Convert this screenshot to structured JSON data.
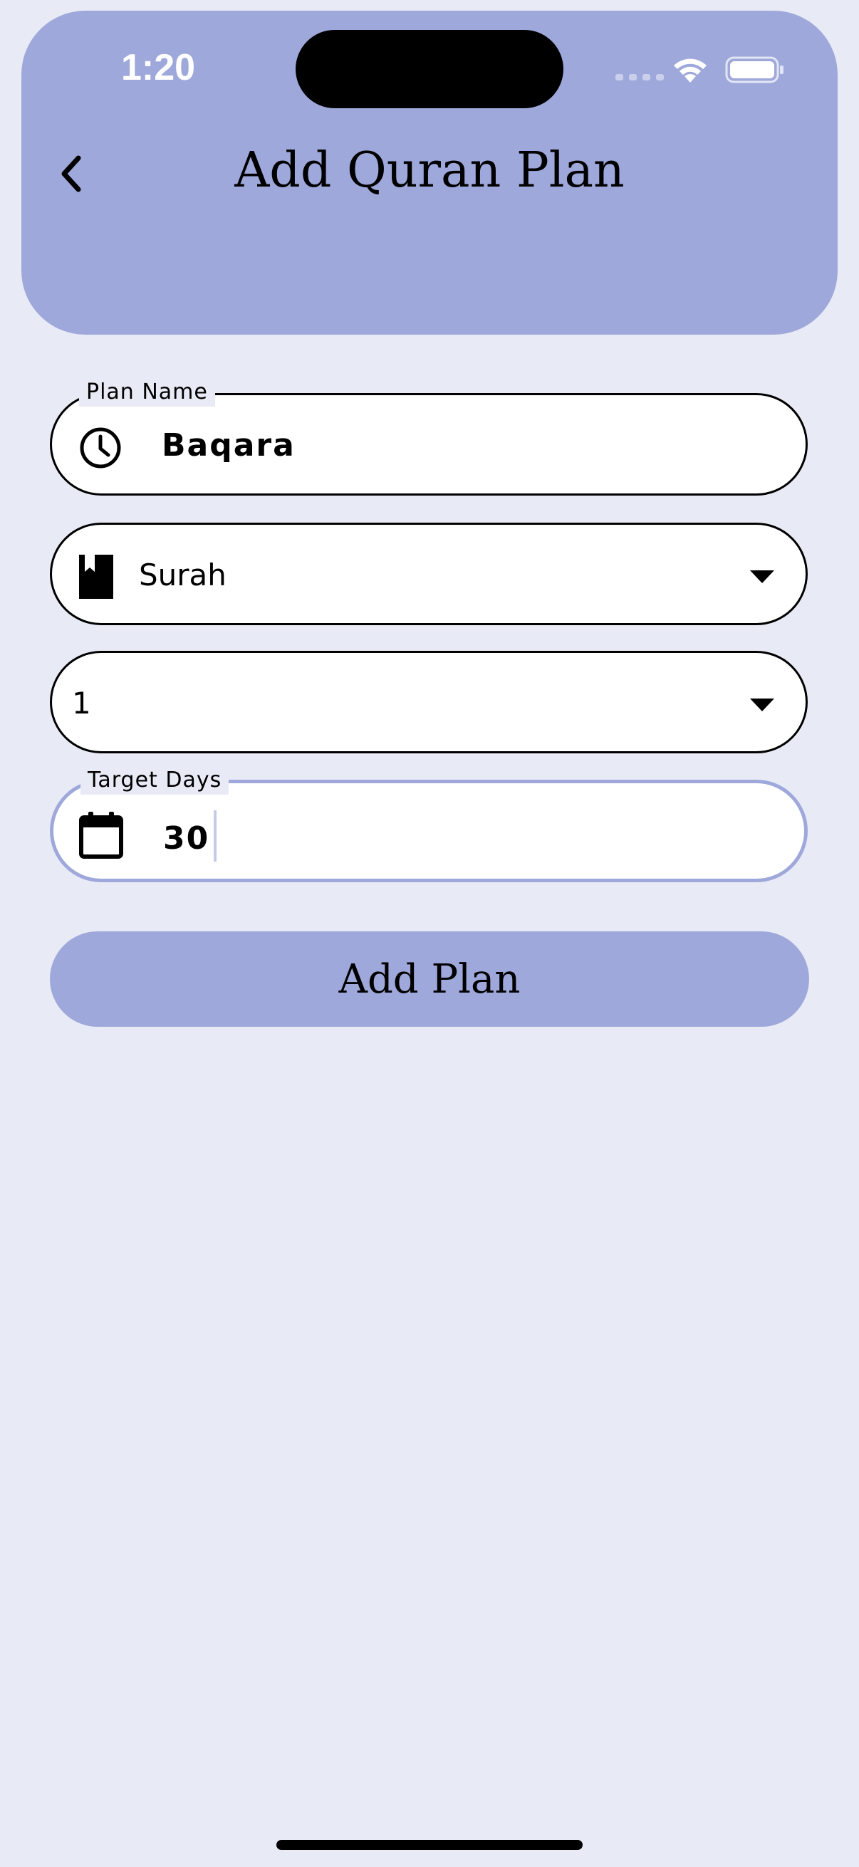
{
  "status_bar": {
    "time": "1:20"
  },
  "header": {
    "title": "Add Quran Plan",
    "back_icon": "chevron-left-icon",
    "background_color": "#9FA8DA"
  },
  "form": {
    "plan_name": {
      "label": "Plan Name",
      "value": "Baqara",
      "icon": "clock-icon"
    },
    "plan_type": {
      "selected": "Surah",
      "icon": "book-bookmark-icon"
    },
    "surah_number": {
      "selected": "1"
    },
    "target_days": {
      "label": "Target Days",
      "value": "30",
      "icon": "calendar-icon",
      "focused": true
    },
    "submit_label": "Add Plan"
  },
  "colors": {
    "accent": "#9FA8DA",
    "page_background": "#E8EAF6",
    "field_background": "#FFFFFF"
  }
}
